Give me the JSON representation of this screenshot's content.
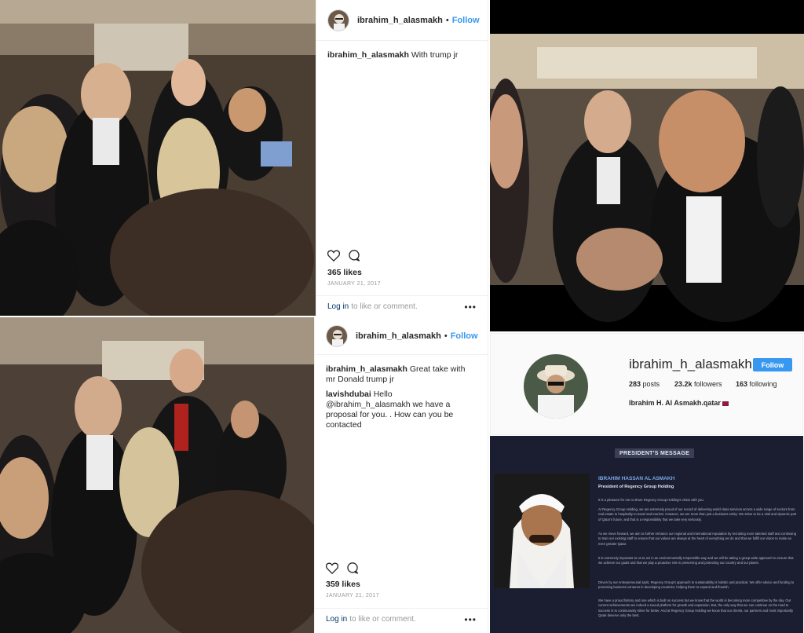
{
  "post1": {
    "username": "ibrahim_h_alasmakh",
    "follow": "Follow",
    "caption_user": "ibrahim_h_alasmakh",
    "caption_text": "With trump jr",
    "likes": "365 likes",
    "date": "JANUARY 21, 2017",
    "login_link": "Log in",
    "login_text": "to like or comment.",
    "more": "•••"
  },
  "post2": {
    "username": "ibrahim_h_alasmakh",
    "follow": "Follow",
    "caption_user": "ibrahim_h_alasmakh",
    "caption_text": "Great take with mr Donald trump jr",
    "comment_user": "lavishdubai",
    "comment_text": "Hello @ibrahim_h_alasmakh we have a proposal for you. . How can you be contacted",
    "likes": "359 likes",
    "date": "JANUARY 21, 2017",
    "login_link": "Log in",
    "login_text": "to like or comment.",
    "more": "•••"
  },
  "profile": {
    "username": "ibrahim_h_alasmakh",
    "follow": "Follow",
    "posts_count": "283",
    "posts_label": "posts",
    "followers_count": "23.2k",
    "followers_label": "followers",
    "following_count": "163",
    "following_label": "following",
    "full_name": "Ibrahim H. Al Asmakh.qatar"
  },
  "president": {
    "title": "PRESIDENT'S MESSAGE",
    "name": "IBRAHIM HASSAN AL ASMAKH",
    "role": "President of Regency Group Holding",
    "p1": "It is a pleasure for me to share Regency Group Holding's vision with you.",
    "p2": "At Regency Group Holding, we are extremely proud of our record of delivering world class services across a wide range of sectors from real estate to hospitality to travel and tourism. However, we are more than just a business entity: We strive to be a vital and dynamic part of Qatar's future, and that is a responsibility that we take very seriously.",
    "p3": "As we move forward, we aim to further enhance our regional and international reputation by recruiting more talented staff and continuing to train our existing staff to ensure that our values are always at the heart of everything we do and that we fulfill our vision to make an even greater Qatar.",
    "p4": "It is extremely important to us to act in an environmentally responsible way and we will be taking a group-wide approach to ensure that we achieve our goals and that we play a proactive role in preserving and protecting our country and our planet.",
    "p5": "Driven by our entrepreneurial spirit, Regency Group's approach to sustainability is holistic and practical. We offer advice and funding to promising business ventures in developing countries, helping them to expand and flourish.",
    "p6": "We have a proud history and one which is built on success but we know that the world is becoming more competitive by the day. Our current achievements are indeed a sound platform for growth and expansion. But, the only way that we can continue on the road to success is to continuously strive for better. And at Regency Group Holding we know that our clients, our partners and most importantly Qatar deserve only the best."
  }
}
